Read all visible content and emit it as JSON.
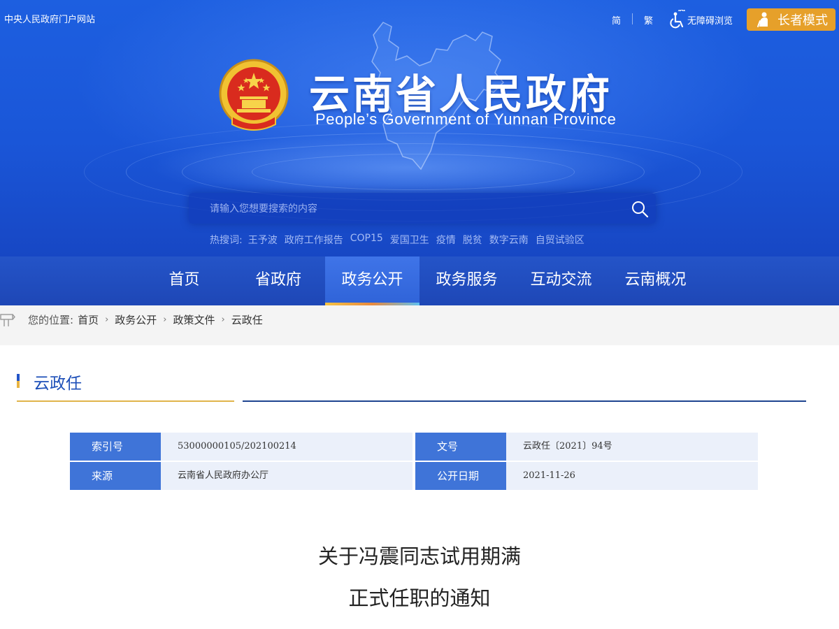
{
  "header": {
    "top_link": "中央人民政府门户网站",
    "lang_simplified": "简",
    "lang_traditional": "繁",
    "accessibility": "无障碍浏览",
    "elder_mode": "长者模式",
    "site_title": "云南省人民政府",
    "site_subtitle": "People’s Government of Yunnan Province",
    "search": {
      "placeholder": "请输入您想要搜索的内容"
    },
    "hot": {
      "label": "热搜词:",
      "keywords": [
        "王予波",
        "政府工作报告",
        "COP15",
        "爱国卫生",
        "疫情",
        "脱贫",
        "数字云南",
        "自贸试验区"
      ]
    }
  },
  "nav": {
    "items": [
      "首页",
      "省政府",
      "政务公开",
      "政务服务",
      "互动交流",
      "云南概况"
    ],
    "active": "政务公开"
  },
  "breadcrumb": {
    "label": "您的位置:",
    "items": [
      "首页",
      "政务公开",
      "政策文件",
      "云政任"
    ]
  },
  "section": {
    "title": "云政任"
  },
  "info": {
    "index_label": "索引号",
    "index_value": "53000000105/202100214",
    "docno_label": "文号",
    "docno_value": "云政任〔2021〕94号",
    "source_label": "来源",
    "source_value": "云南省人民政府办公厅",
    "date_label": "公开日期",
    "date_value": "2021-11-26"
  },
  "document": {
    "title_line1": "关于冯震同志试用期满",
    "title_line2": "正式任职的通知"
  },
  "colors": {
    "header_blue": "#1a56d8",
    "nav_blue": "#2454c8",
    "accent_gold": "#e6a02a",
    "label_blue": "#3f74d8"
  }
}
